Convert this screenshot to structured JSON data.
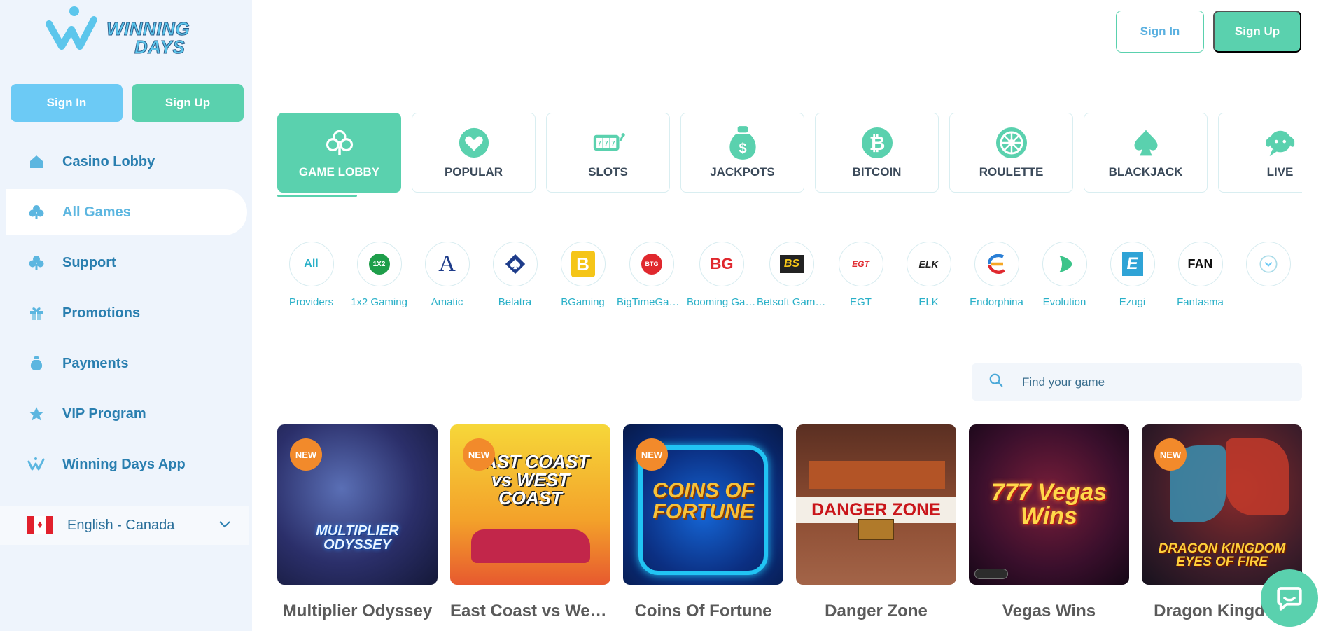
{
  "brand": {
    "logo_line1": "WINNING",
    "logo_line2": "DAYS"
  },
  "sidebar": {
    "sign_in": "Sign In",
    "sign_up": "Sign Up",
    "items": [
      {
        "label": "Casino Lobby",
        "icon": "house-icon"
      },
      {
        "label": "All Games",
        "icon": "club-icon"
      },
      {
        "label": "Support",
        "icon": "club-icon"
      },
      {
        "label": "Promotions",
        "icon": "gift-icon"
      },
      {
        "label": "Payments",
        "icon": "money-bag-icon"
      },
      {
        "label": "VIP Program",
        "icon": "star-icon"
      },
      {
        "label": "Winning Days App",
        "icon": "logo-w-icon"
      }
    ],
    "language": "English - Canada"
  },
  "header": {
    "sign_in": "Sign In",
    "sign_up": "Sign Up"
  },
  "categories": [
    {
      "label": "GAME LOBBY",
      "icon": "club-icon"
    },
    {
      "label": "POPULAR",
      "icon": "heart-icon"
    },
    {
      "label": "SLOTS",
      "icon": "slot-machine-icon"
    },
    {
      "label": "JACKPOTS",
      "icon": "money-bag-icon"
    },
    {
      "label": "BITCOIN",
      "icon": "bitcoin-icon"
    },
    {
      "label": "ROULETTE",
      "icon": "roulette-icon"
    },
    {
      "label": "BLACKJACK",
      "icon": "spade-icon"
    },
    {
      "label": "LIVE",
      "icon": "live-chat-icon"
    }
  ],
  "providers": [
    {
      "name": "Providers",
      "logo": "All"
    },
    {
      "name": "1x2 Gaming",
      "logo": "1X2"
    },
    {
      "name": "Amatic",
      "logo": "A"
    },
    {
      "name": "Belatra",
      "logo": ""
    },
    {
      "name": "BGaming",
      "logo": "B"
    },
    {
      "name": "BigTimeGaming",
      "logo": "BTG"
    },
    {
      "name": "Booming Games",
      "logo": "BG"
    },
    {
      "name": "Betsoft Gaming",
      "logo": "BS"
    },
    {
      "name": "EGT",
      "logo": "EGT"
    },
    {
      "name": "ELK",
      "logo": "ELK"
    },
    {
      "name": "Endorphina",
      "logo": ""
    },
    {
      "name": "Evolution",
      "logo": ""
    },
    {
      "name": "Ezugi",
      "logo": "E"
    },
    {
      "name": "Fantasma",
      "logo": "FAN"
    }
  ],
  "search": {
    "placeholder": "Find your game"
  },
  "games": [
    {
      "title": "Multiplier Odyssey",
      "badge": "NEW",
      "art": "MULTIPLIER ODYSSEY"
    },
    {
      "title": "East Coast vs West Coast",
      "badge": "NEW",
      "art": "EAST COAST vs WEST COAST"
    },
    {
      "title": "Coins Of Fortune",
      "badge": "NEW",
      "art": "COINS OF FORTUNE"
    },
    {
      "title": "Danger Zone",
      "badge": "",
      "art": "DANGER ZONE"
    },
    {
      "title": "Vegas Wins",
      "badge": "",
      "art": "777 Vegas Wins"
    },
    {
      "title": "Dragon Kingdom",
      "badge": "NEW",
      "art": "DRAGON KINGDOM EYES OF FIRE"
    }
  ],
  "colors": {
    "accent": "#5ad1ae",
    "blue": "#6ccaf5",
    "badge": "#f28a2b"
  }
}
